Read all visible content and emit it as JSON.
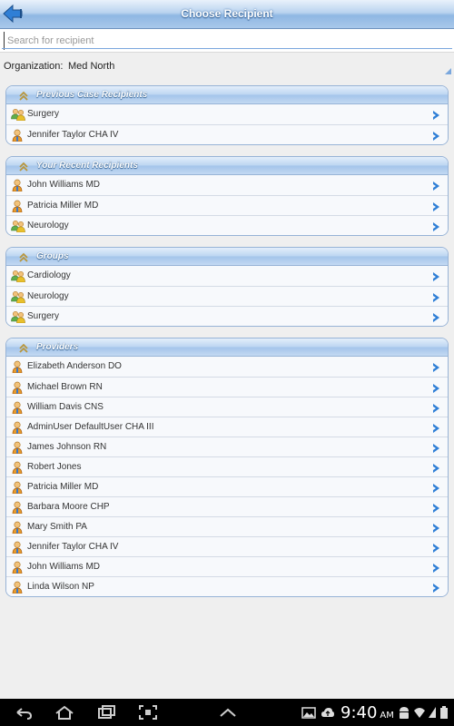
{
  "header": {
    "title": "Choose Recipient"
  },
  "search": {
    "placeholder": "Search for recipient"
  },
  "organization": {
    "label": "Organization:",
    "value": "Med North"
  },
  "sections": [
    {
      "title": "Previous Case Recipients",
      "items": [
        {
          "label": "Surgery",
          "type": "group"
        },
        {
          "label": "Jennifer Taylor CHA IV",
          "type": "person"
        }
      ]
    },
    {
      "title": "Your Recent Recipients",
      "items": [
        {
          "label": "John Williams MD",
          "type": "person"
        },
        {
          "label": "Patricia Miller MD",
          "type": "person"
        },
        {
          "label": "Neurology",
          "type": "group"
        }
      ]
    },
    {
      "title": "Groups",
      "items": [
        {
          "label": "Cardiology",
          "type": "group"
        },
        {
          "label": "Neurology",
          "type": "group"
        },
        {
          "label": "Surgery",
          "type": "group"
        }
      ]
    },
    {
      "title": "Providers",
      "items": [
        {
          "label": "Elizabeth Anderson DO",
          "type": "person"
        },
        {
          "label": "Michael Brown RN",
          "type": "person"
        },
        {
          "label": "William Davis CNS",
          "type": "person"
        },
        {
          "label": "AdminUser DefaultUser CHA III",
          "type": "person"
        },
        {
          "label": "James Johnson RN",
          "type": "person"
        },
        {
          "label": "Robert Jones",
          "type": "person"
        },
        {
          "label": "Patricia Miller MD",
          "type": "person"
        },
        {
          "label": "Barbara Moore CHP",
          "type": "person"
        },
        {
          "label": "Mary Smith PA",
          "type": "person"
        },
        {
          "label": "Jennifer Taylor CHA IV",
          "type": "person"
        },
        {
          "label": "John Williams MD",
          "type": "person"
        },
        {
          "label": "Linda Wilson NP",
          "type": "person"
        }
      ]
    }
  ],
  "icons": {
    "back": "back-arrow-icon",
    "section": "double-chevron-up-icon",
    "person": "person-icon",
    "group": "group-icon",
    "row_arrow": "chevron-right-icon"
  },
  "statusbar": {
    "time": "9:40",
    "ampm": "AM"
  },
  "colors": {
    "accent": "#2f7fd6",
    "header_text": "#ffffff"
  }
}
